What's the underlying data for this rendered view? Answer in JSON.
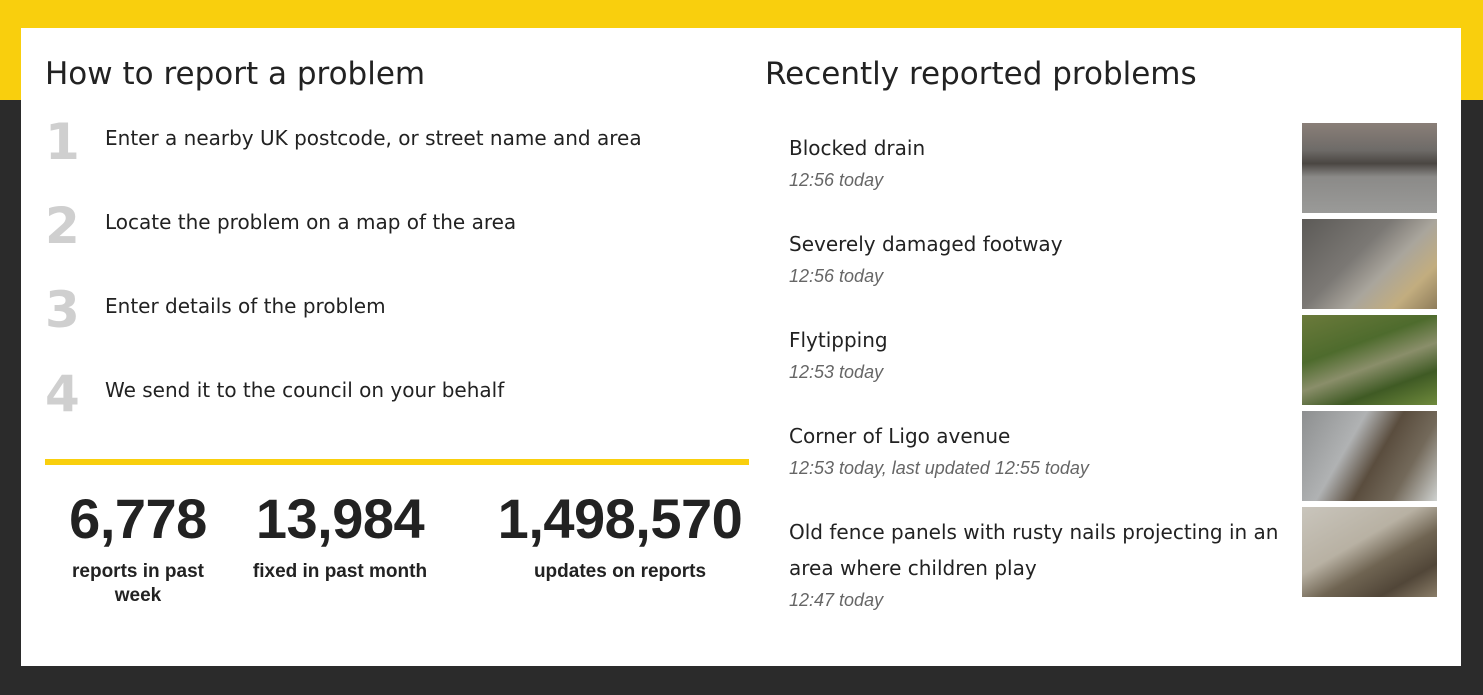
{
  "how_to": {
    "title": "How to report a problem",
    "steps": [
      {
        "num": "1",
        "text": "Enter a nearby UK postcode, or street name and area"
      },
      {
        "num": "2",
        "text": "Locate the problem on a map of the area"
      },
      {
        "num": "3",
        "text": "Enter details of the problem"
      },
      {
        "num": "4",
        "text": "We send it to the council on your behalf"
      }
    ]
  },
  "stats": [
    {
      "value": "6,778",
      "label": "reports in past week"
    },
    {
      "value": "13,984",
      "label": "fixed in past month"
    },
    {
      "value": "1,498,570",
      "label": "updates on reports"
    }
  ],
  "recent": {
    "title": "Recently reported problems",
    "items": [
      {
        "title": "Blocked drain",
        "meta": "12:56 today"
      },
      {
        "title": "Severely damaged footway",
        "meta": "12:56 today"
      },
      {
        "title": "Flytipping",
        "meta": "12:53 today"
      },
      {
        "title": "Corner of Ligo avenue",
        "meta": "12:53 today, last updated 12:55 today"
      },
      {
        "title": "Old fence panels with rusty nails projecting in an area where children play",
        "meta": "12:47 today"
      }
    ]
  },
  "colors": {
    "accent_yellow": "#f9cf0d",
    "background_dark": "#2b2b2b",
    "step_number_gray": "#cfcfcf"
  }
}
